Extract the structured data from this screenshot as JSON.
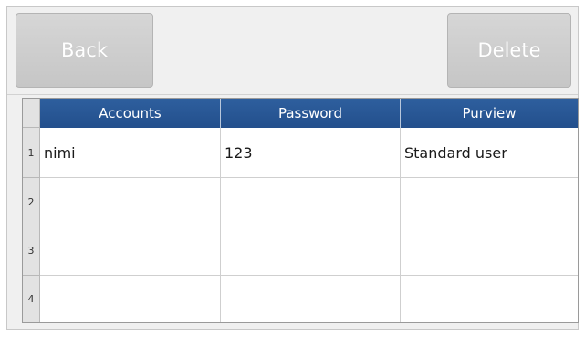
{
  "toolbar": {
    "back_label": "Back",
    "delete_label": "Delete"
  },
  "table": {
    "columns": [
      "Accounts",
      "Password",
      "Purview"
    ],
    "rows": [
      {
        "num": "1",
        "account": "nimi",
        "password": "123",
        "purview": "Standard user"
      },
      {
        "num": "2",
        "account": "",
        "password": "",
        "purview": ""
      },
      {
        "num": "3",
        "account": "",
        "password": "",
        "purview": ""
      },
      {
        "num": "4",
        "account": "",
        "password": "",
        "purview": ""
      }
    ]
  },
  "colors": {
    "header_bg": "#2a5796",
    "button_bg": "#cfcfcf",
    "panel_bg": "#f0f0f0"
  }
}
